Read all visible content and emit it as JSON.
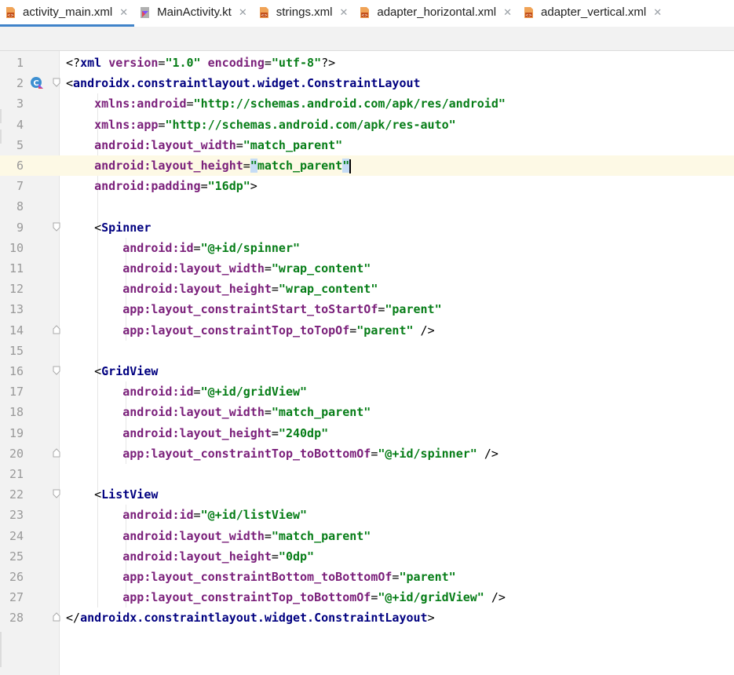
{
  "tabs": [
    {
      "label": "activity_main.xml",
      "icon": "xml-file-icon",
      "active": true,
      "closable": true
    },
    {
      "label": "MainActivity.kt",
      "icon": "kotlin-file-icon",
      "active": false,
      "closable": true
    },
    {
      "label": "strings.xml",
      "icon": "xml-file-icon",
      "active": false,
      "closable": true
    },
    {
      "label": "adapter_horizontal.xml",
      "icon": "xml-file-icon",
      "active": false,
      "closable": true
    },
    {
      "label": "adapter_vertical.xml",
      "icon": "xml-file-icon",
      "active": false,
      "closable": true
    }
  ],
  "close_glyph": "✕",
  "current_line": 6,
  "lines": [
    {
      "n": "1",
      "indent": 0,
      "tokens": [
        [
          "br",
          "<?"
        ],
        [
          "pi",
          "xml "
        ],
        [
          "at",
          "version"
        ],
        [
          "br",
          "="
        ],
        [
          "str",
          "\"1.0\""
        ],
        [
          "br",
          " "
        ],
        [
          "at",
          "encoding"
        ],
        [
          "br",
          "="
        ],
        [
          "str",
          "\"utf-8\""
        ],
        [
          "br",
          "?>"
        ]
      ]
    },
    {
      "n": "2",
      "indent": 0,
      "fold": "open",
      "gutter_icon": "kotlin-class-icon",
      "tokens": [
        [
          "br",
          "<"
        ],
        [
          "tag",
          "androidx.constraintlayout.widget.ConstraintLayout"
        ]
      ]
    },
    {
      "n": "3",
      "indent": 1,
      "tokens": [
        [
          "ns",
          "xmlns:"
        ],
        [
          "at",
          "android"
        ],
        [
          "br",
          "="
        ],
        [
          "str",
          "\"http://schemas.android.com/apk/res/android\""
        ]
      ]
    },
    {
      "n": "4",
      "indent": 1,
      "tokens": [
        [
          "ns",
          "xmlns:"
        ],
        [
          "at",
          "app"
        ],
        [
          "br",
          "="
        ],
        [
          "str",
          "\"http://schemas.android.com/apk/res-auto\""
        ]
      ]
    },
    {
      "n": "5",
      "indent": 1,
      "tokens": [
        [
          "ns",
          "android:"
        ],
        [
          "at",
          "layout_width"
        ],
        [
          "br",
          "="
        ],
        [
          "str",
          "\"match_parent\""
        ]
      ]
    },
    {
      "n": "6",
      "indent": 1,
      "tokens": [
        [
          "ns",
          "android:"
        ],
        [
          "at",
          "layout_height"
        ],
        [
          "br",
          "="
        ],
        [
          "hl",
          "\""
        ],
        [
          "str",
          "match_parent"
        ],
        [
          "hl",
          "\""
        ],
        [
          "caret",
          ""
        ]
      ]
    },
    {
      "n": "7",
      "indent": 1,
      "tokens": [
        [
          "ns",
          "android:"
        ],
        [
          "at",
          "padding"
        ],
        [
          "br",
          "="
        ],
        [
          "str",
          "\"16dp\""
        ],
        [
          "br",
          ">"
        ]
      ]
    },
    {
      "n": "8",
      "indent": 0,
      "tokens": []
    },
    {
      "n": "9",
      "indent": 1,
      "fold": "open",
      "tokens": [
        [
          "br",
          "<"
        ],
        [
          "tag",
          "Spinner"
        ]
      ]
    },
    {
      "n": "10",
      "indent": 2,
      "tokens": [
        [
          "ns",
          "android:"
        ],
        [
          "at",
          "id"
        ],
        [
          "br",
          "="
        ],
        [
          "str",
          "\"@+id/spinner\""
        ]
      ]
    },
    {
      "n": "11",
      "indent": 2,
      "tokens": [
        [
          "ns",
          "android:"
        ],
        [
          "at",
          "layout_width"
        ],
        [
          "br",
          "="
        ],
        [
          "str",
          "\"wrap_content\""
        ]
      ]
    },
    {
      "n": "12",
      "indent": 2,
      "tokens": [
        [
          "ns",
          "android:"
        ],
        [
          "at",
          "layout_height"
        ],
        [
          "br",
          "="
        ],
        [
          "str",
          "\"wrap_content\""
        ]
      ]
    },
    {
      "n": "13",
      "indent": 2,
      "tokens": [
        [
          "ns",
          "app:"
        ],
        [
          "at",
          "layout_constraintStart_toStartOf"
        ],
        [
          "br",
          "="
        ],
        [
          "str",
          "\"parent\""
        ]
      ]
    },
    {
      "n": "14",
      "indent": 2,
      "fold": "close",
      "tokens": [
        [
          "ns",
          "app:"
        ],
        [
          "at",
          "layout_constraintTop_toTopOf"
        ],
        [
          "br",
          "="
        ],
        [
          "str",
          "\"parent\""
        ],
        [
          "br",
          " />"
        ]
      ]
    },
    {
      "n": "15",
      "indent": 0,
      "tokens": []
    },
    {
      "n": "16",
      "indent": 1,
      "fold": "open",
      "tokens": [
        [
          "br",
          "<"
        ],
        [
          "tag",
          "GridView"
        ]
      ]
    },
    {
      "n": "17",
      "indent": 2,
      "tokens": [
        [
          "ns",
          "android:"
        ],
        [
          "at",
          "id"
        ],
        [
          "br",
          "="
        ],
        [
          "str",
          "\"@+id/gridView\""
        ]
      ]
    },
    {
      "n": "18",
      "indent": 2,
      "tokens": [
        [
          "ns",
          "android:"
        ],
        [
          "at",
          "layout_width"
        ],
        [
          "br",
          "="
        ],
        [
          "str",
          "\"match_parent\""
        ]
      ]
    },
    {
      "n": "19",
      "indent": 2,
      "tokens": [
        [
          "ns",
          "android:"
        ],
        [
          "at",
          "layout_height"
        ],
        [
          "br",
          "="
        ],
        [
          "str",
          "\"240dp\""
        ]
      ]
    },
    {
      "n": "20",
      "indent": 2,
      "fold": "close",
      "tokens": [
        [
          "ns",
          "app:"
        ],
        [
          "at",
          "layout_constraintTop_toBottomOf"
        ],
        [
          "br",
          "="
        ],
        [
          "str",
          "\"@+id/spinner\""
        ],
        [
          "br",
          " />"
        ]
      ]
    },
    {
      "n": "21",
      "indent": 0,
      "tokens": []
    },
    {
      "n": "22",
      "indent": 1,
      "fold": "open",
      "tokens": [
        [
          "br",
          "<"
        ],
        [
          "tag",
          "ListView"
        ]
      ]
    },
    {
      "n": "23",
      "indent": 2,
      "tokens": [
        [
          "ns",
          "android:"
        ],
        [
          "at",
          "id"
        ],
        [
          "br",
          "="
        ],
        [
          "str",
          "\"@+id/listView\""
        ]
      ]
    },
    {
      "n": "24",
      "indent": 2,
      "tokens": [
        [
          "ns",
          "android:"
        ],
        [
          "at",
          "layout_width"
        ],
        [
          "br",
          "="
        ],
        [
          "str",
          "\"match_parent\""
        ]
      ]
    },
    {
      "n": "25",
      "indent": 2,
      "tokens": [
        [
          "ns",
          "android:"
        ],
        [
          "at",
          "layout_height"
        ],
        [
          "br",
          "="
        ],
        [
          "str",
          "\"0dp\""
        ]
      ]
    },
    {
      "n": "26",
      "indent": 2,
      "tokens": [
        [
          "ns",
          "app:"
        ],
        [
          "at",
          "layout_constraintBottom_toBottomOf"
        ],
        [
          "br",
          "="
        ],
        [
          "str",
          "\"parent\""
        ]
      ]
    },
    {
      "n": "27",
      "indent": 2,
      "tokens": [
        [
          "ns",
          "app:"
        ],
        [
          "at",
          "layout_constraintTop_toBottomOf"
        ],
        [
          "br",
          "="
        ],
        [
          "str",
          "\"@+id/gridView\""
        ],
        [
          "br",
          " />"
        ]
      ]
    },
    {
      "n": "28",
      "indent": 0,
      "fold": "close",
      "tokens": [
        [
          "br",
          "</"
        ],
        [
          "tag",
          "androidx.constraintlayout.widget.ConstraintLayout"
        ],
        [
          "br",
          ">"
        ]
      ]
    }
  ]
}
